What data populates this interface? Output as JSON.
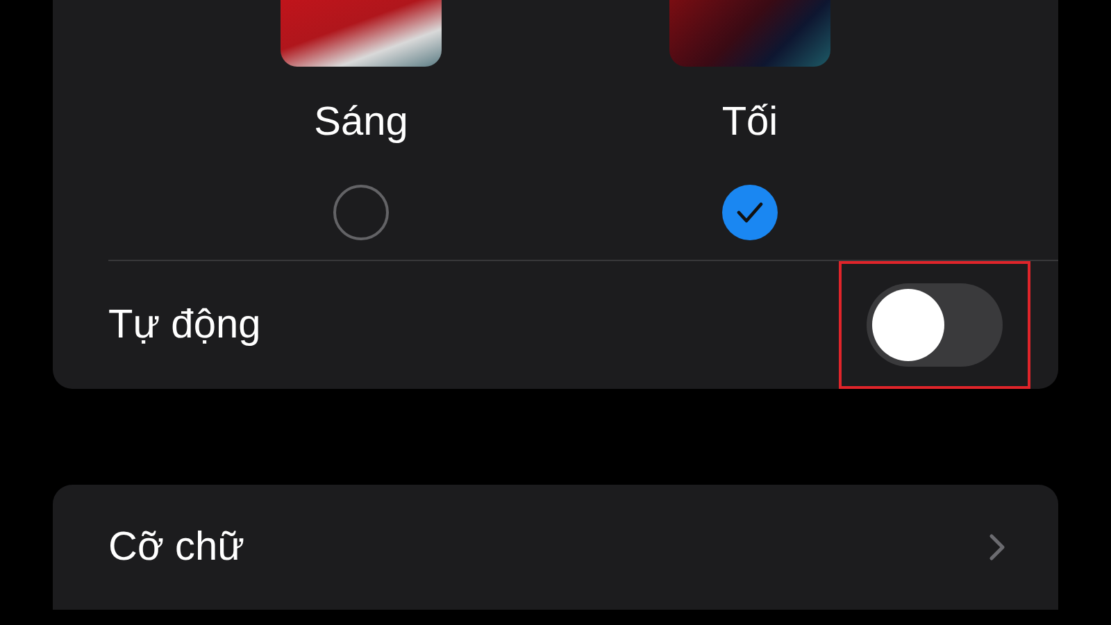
{
  "appearance": {
    "options": [
      {
        "label": "Sáng",
        "kind": "light",
        "selected": false
      },
      {
        "label": "Tối",
        "kind": "dark",
        "selected": true
      }
    ],
    "automatic": {
      "label": "Tự động",
      "on": false,
      "highlighted": true
    }
  },
  "text_size": {
    "label": "Cỡ chữ"
  }
}
